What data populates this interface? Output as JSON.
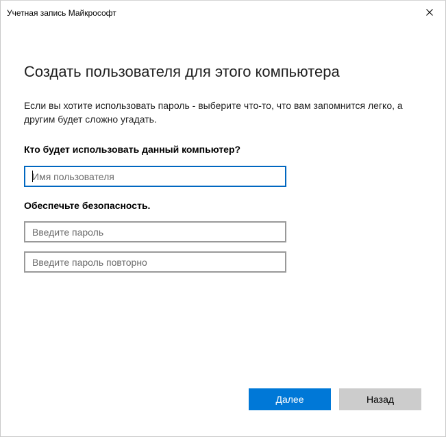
{
  "window": {
    "title": "Учетная запись Майкрософт",
    "close_icon": "close-icon"
  },
  "page": {
    "heading": "Создать пользователя для этого компьютера",
    "description": "Если вы хотите использовать пароль - выберите что-то, что вам запомнится легко, а другим будет сложно угадать.",
    "who_label": "Кто будет использовать данный компьютер?",
    "username": {
      "value": "",
      "placeholder": "Имя пользователя"
    },
    "security_label": "Обеспечьте безопасность.",
    "password": {
      "value": "",
      "placeholder": "Введите пароль"
    },
    "password_repeat": {
      "value": "",
      "placeholder": "Введите пароль повторно"
    }
  },
  "buttons": {
    "next_label": "Далее",
    "back_label": "Назад"
  },
  "colors": {
    "accent": "#0078d7",
    "focus_border": "#0067c0",
    "secondary_button": "#cccccc"
  }
}
